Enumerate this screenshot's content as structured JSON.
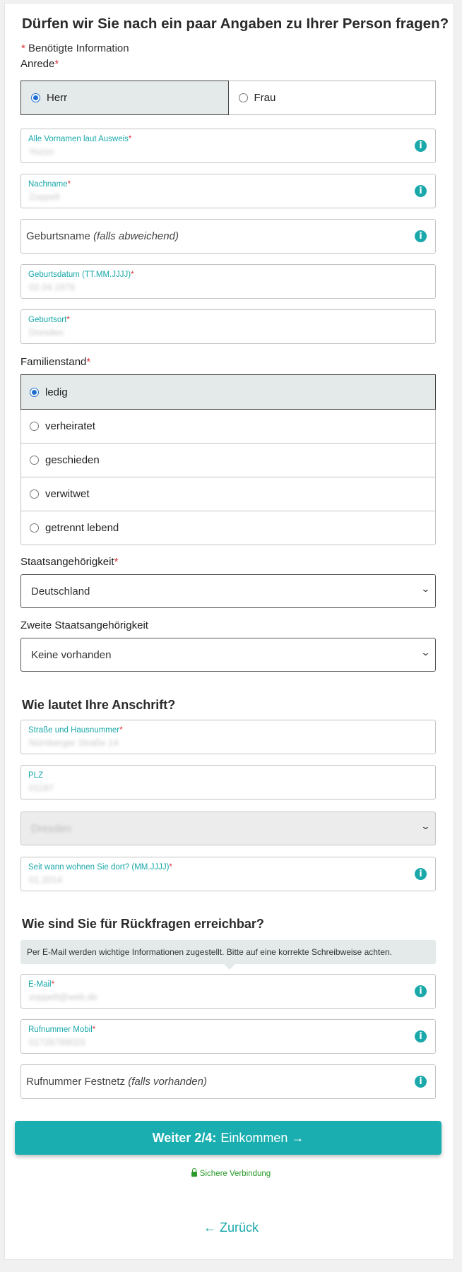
{
  "personal": {
    "title": "Dürfen wir Sie nach ein paar Angaben zu Ihrer Person fragen?",
    "required_note": "Benötigte Information",
    "salutation_label": "Anrede",
    "salutation_options": [
      "Herr",
      "Frau"
    ],
    "salutation_selected": "Herr",
    "first_names": {
      "label": "Alle Vornamen laut Ausweis",
      "value": "Yozzo"
    },
    "last_name": {
      "label": "Nachname",
      "value": "Zoppelt"
    },
    "birth_name": {
      "placeholder": "Geburtsname",
      "placeholder_hint": "(falls abweichend)"
    },
    "birth_date": {
      "label": "Geburtsdatum (TT.MM.JJJJ)",
      "value": "02.04.1976"
    },
    "birth_place": {
      "label": "Geburtsort",
      "value": "Dresden"
    },
    "marital_label": "Familienstand",
    "marital_options": [
      "ledig",
      "verheiratet",
      "geschieden",
      "verwitwet",
      "getrennt lebend"
    ],
    "marital_selected": "ledig",
    "nationality_label": "Staatsangehörigkeit",
    "nationality_value": "Deutschland",
    "second_nationality_label": "Zweite Staatsangehörigkeit",
    "second_nationality_value": "Keine vorhanden"
  },
  "address": {
    "title": "Wie lautet Ihre Anschrift?",
    "street": {
      "label": "Straße und Hausnummer",
      "value": "Nürnberger Straße 14"
    },
    "zip": {
      "label": "PLZ",
      "value": "01187"
    },
    "city_value": "Dresden",
    "since": {
      "label": "Seit wann wohnen Sie dort? (MM.JJJJ)",
      "value": "01.2014"
    }
  },
  "contact": {
    "title": "Wie sind Sie für Rückfragen erreichbar?",
    "hint": "Per E-Mail werden wichtige Informationen zugestellt. Bitte auf eine korrekte Schreibweise achten.",
    "email": {
      "label": "E-Mail",
      "value": "zoppelt@web.de"
    },
    "mobile": {
      "label": "Rufnummer Mobil",
      "value": "01726789023"
    },
    "landline": {
      "placeholder": "Rufnummer Festnetz",
      "placeholder_hint": "(falls vorhanden)"
    }
  },
  "actions": {
    "next_step": "Weiter 2/4:",
    "next_label": "Einkommen →",
    "secure": "Sichere Verbindung",
    "back": "← Zurück"
  },
  "colors": {
    "accent": "#1aaeb0",
    "required": "#d9323a",
    "selected_bg": "#e4eaea",
    "secure": "#2a9a2a"
  },
  "icons": [
    "info-icon",
    "lock-icon",
    "chevron-down-icon"
  ]
}
